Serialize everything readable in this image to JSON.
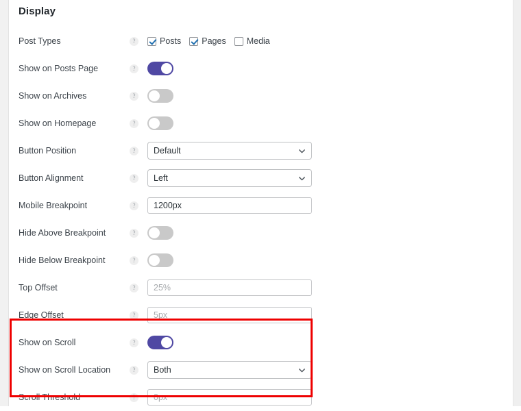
{
  "section": {
    "title": "Display"
  },
  "help_glyph": "?",
  "colors": {
    "toggle_on": "#4f48a3",
    "toggle_off": "#c9c9c9",
    "checkbox_check": "#2271b1",
    "highlight_border": "#ee0000"
  },
  "rows": [
    {
      "label": "Post Types",
      "type": "checkboxes",
      "options": [
        {
          "label": "Posts",
          "checked": true
        },
        {
          "label": "Pages",
          "checked": true
        },
        {
          "label": "Media",
          "checked": false
        }
      ]
    },
    {
      "label": "Show on Posts Page",
      "type": "toggle",
      "on": true
    },
    {
      "label": "Show on Archives",
      "type": "toggle",
      "on": false
    },
    {
      "label": "Show on Homepage",
      "type": "toggle",
      "on": false
    },
    {
      "label": "Button Position",
      "type": "select",
      "value": "Default"
    },
    {
      "label": "Button Alignment",
      "type": "select",
      "value": "Left"
    },
    {
      "label": "Mobile Breakpoint",
      "type": "input",
      "value": "1200px",
      "is_placeholder": false
    },
    {
      "label": "Hide Above Breakpoint",
      "type": "toggle",
      "on": false
    },
    {
      "label": "Hide Below Breakpoint",
      "type": "toggle",
      "on": false
    },
    {
      "label": "Top Offset",
      "type": "input",
      "value": "25%",
      "is_placeholder": true
    },
    {
      "label": "Edge Offset",
      "type": "input",
      "value": "5px",
      "is_placeholder": true
    },
    {
      "label": "Show on Scroll",
      "type": "toggle",
      "on": true,
      "highlighted": true
    },
    {
      "label": "Show on Scroll Location",
      "type": "select",
      "value": "Both",
      "highlighted": true
    },
    {
      "label": "Scroll Threshold",
      "type": "input",
      "value": "0px",
      "is_placeholder": true,
      "highlighted": true
    }
  ],
  "annotation": {
    "kind": "red-rectangle-highlight",
    "covers": [
      "Show on Scroll",
      "Show on Scroll Location",
      "Scroll Threshold"
    ]
  }
}
